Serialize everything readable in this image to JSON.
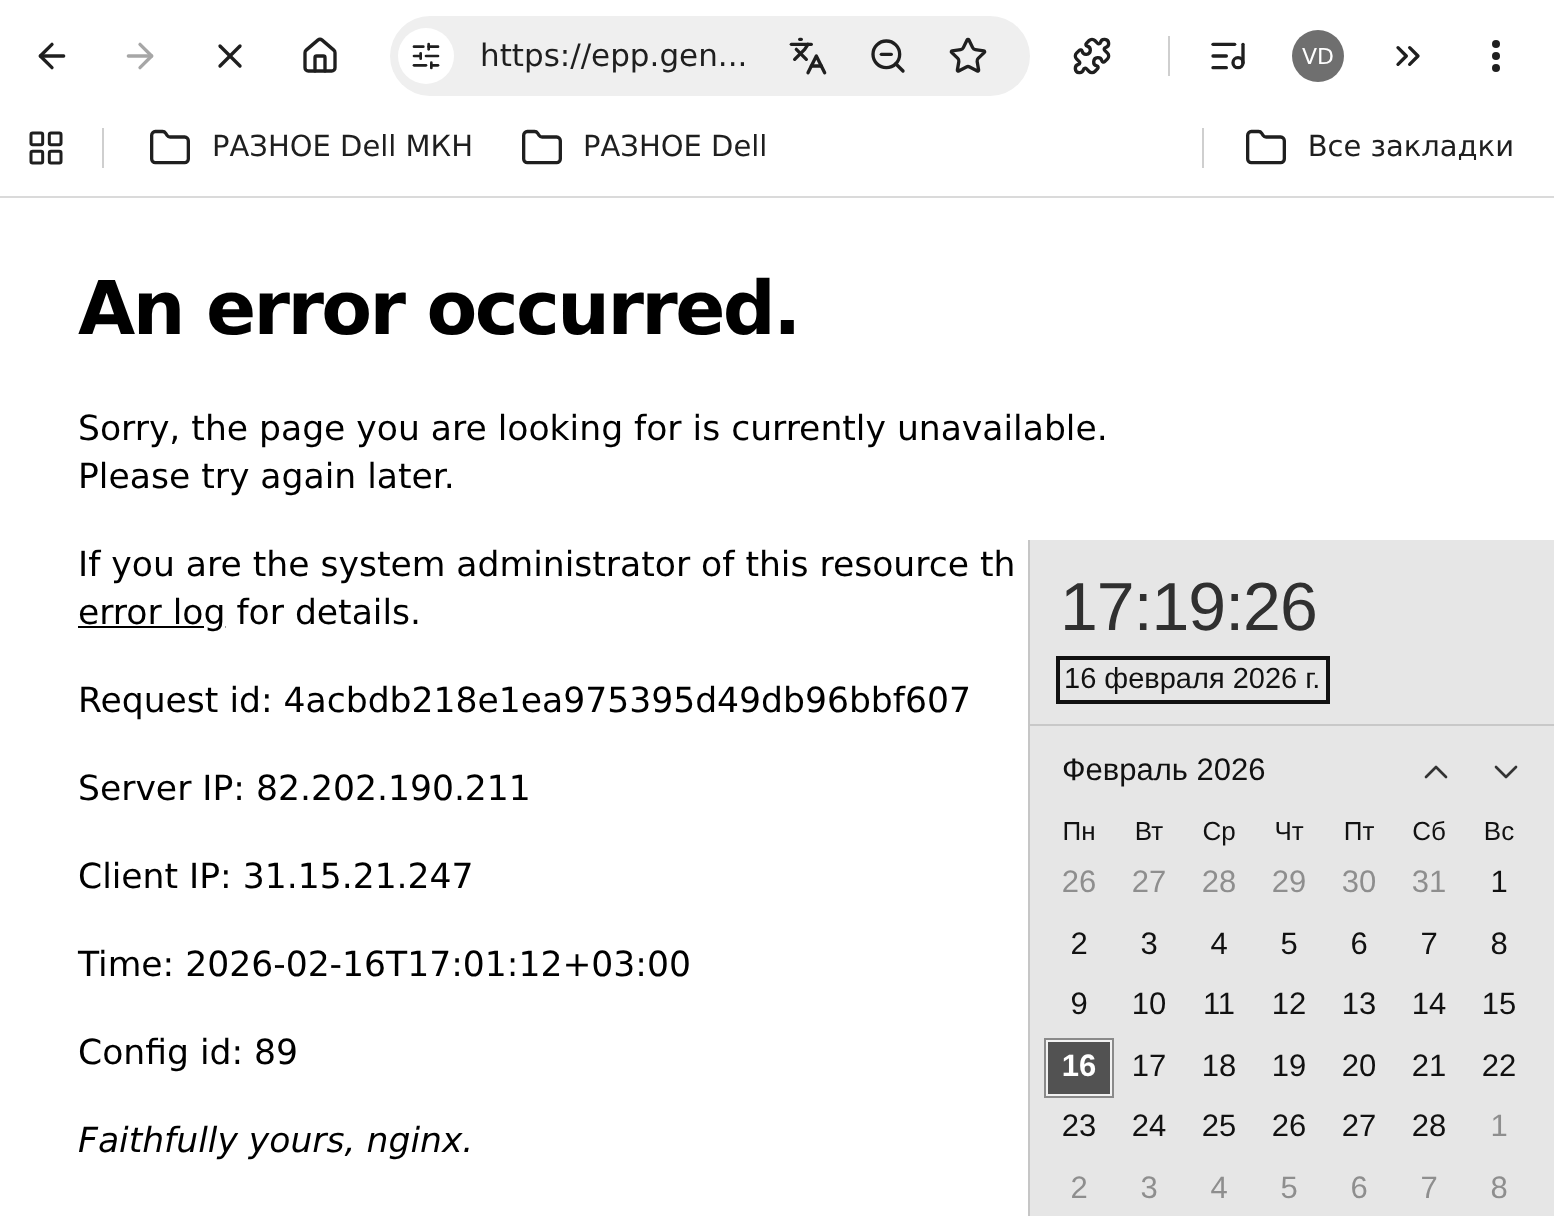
{
  "browser": {
    "forward_button": {
      "disabled": true
    },
    "address_bar": {
      "url": "https://epp.gen..."
    },
    "profile": {
      "initials": "VD"
    }
  },
  "bookmarks_bar": {
    "items": [
      {
        "label": "РАЗНОЕ Dell МКН"
      },
      {
        "label": "РАЗНОЕ Dell"
      }
    ],
    "all_bookmarks": {
      "label": "Все закладки"
    }
  },
  "page": {
    "heading": "An error occurred.",
    "paragraphs": [
      {
        "kind": "text",
        "lines": [
          "Sorry, the page you are looking for is currently unavailable.",
          "Please try again later."
        ]
      },
      {
        "kind": "log_hint",
        "lines": [
          "If you are the system administrator of this resource th"
        ],
        "link": "error log",
        "after_link": "for details."
      },
      {
        "kind": "info",
        "text": "Request id: 4acbdb218e1ea975395d49db96bbf607"
      },
      {
        "kind": "info",
        "text": "Server IP: 82.202.190.211"
      },
      {
        "kind": "info",
        "text": "Client IP: 31.15.21.247"
      },
      {
        "kind": "info",
        "text": "Time: 2026-02-16T17:01:12+03:00"
      },
      {
        "kind": "info",
        "text": "Config id: 89"
      },
      {
        "kind": "signature",
        "text": "Faithfully yours, nginx."
      }
    ]
  },
  "clock_flyout": {
    "time": "17:19:26",
    "date": "16 февраля 2026 г.",
    "month": "Февраль 2026",
    "weekdays": [
      "Пн",
      "Вт",
      "Ср",
      "Чт",
      "Пт",
      "Сб",
      "Вс"
    ],
    "days": [
      {
        "label": "26",
        "other_month": true,
        "selected": false
      },
      {
        "label": "27",
        "other_month": true,
        "selected": false
      },
      {
        "label": "28",
        "other_month": true,
        "selected": false
      },
      {
        "label": "29",
        "other_month": true,
        "selected": false
      },
      {
        "label": "30",
        "other_month": true,
        "selected": false
      },
      {
        "label": "31",
        "other_month": true,
        "selected": false
      },
      {
        "label": "1",
        "other_month": false,
        "selected": false
      },
      {
        "label": "2",
        "other_month": false,
        "selected": false
      },
      {
        "label": "3",
        "other_month": false,
        "selected": false
      },
      {
        "label": "4",
        "other_month": false,
        "selected": false
      },
      {
        "label": "5",
        "other_month": false,
        "selected": false
      },
      {
        "label": "6",
        "other_month": false,
        "selected": false
      },
      {
        "label": "7",
        "other_month": false,
        "selected": false
      },
      {
        "label": "8",
        "other_month": false,
        "selected": false
      },
      {
        "label": "9",
        "other_month": false,
        "selected": false
      },
      {
        "label": "10",
        "other_month": false,
        "selected": false
      },
      {
        "label": "11",
        "other_month": false,
        "selected": false
      },
      {
        "label": "12",
        "other_month": false,
        "selected": false
      },
      {
        "label": "13",
        "other_month": false,
        "selected": false
      },
      {
        "label": "14",
        "other_month": false,
        "selected": false
      },
      {
        "label": "15",
        "other_month": false,
        "selected": false
      },
      {
        "label": "16",
        "other_month": false,
        "selected": true
      },
      {
        "label": "17",
        "other_month": false,
        "selected": false
      },
      {
        "label": "18",
        "other_month": false,
        "selected": false
      },
      {
        "label": "19",
        "other_month": false,
        "selected": false
      },
      {
        "label": "20",
        "other_month": false,
        "selected": false
      },
      {
        "label": "21",
        "other_month": false,
        "selected": false
      },
      {
        "label": "22",
        "other_month": false,
        "selected": false
      },
      {
        "label": "23",
        "other_month": false,
        "selected": false
      },
      {
        "label": "24",
        "other_month": false,
        "selected": false
      },
      {
        "label": "25",
        "other_month": false,
        "selected": false
      },
      {
        "label": "26",
        "other_month": false,
        "selected": false
      },
      {
        "label": "27",
        "other_month": false,
        "selected": false
      },
      {
        "label": "28",
        "other_month": false,
        "selected": false
      },
      {
        "label": "1",
        "other_month": true,
        "selected": false
      },
      {
        "label": "2",
        "other_month": true,
        "selected": false
      },
      {
        "label": "3",
        "other_month": true,
        "selected": false
      },
      {
        "label": "4",
        "other_month": true,
        "selected": false
      },
      {
        "label": "5",
        "other_month": true,
        "selected": false
      },
      {
        "label": "6",
        "other_month": true,
        "selected": false
      },
      {
        "label": "7",
        "other_month": true,
        "selected": false
      },
      {
        "label": "8",
        "other_month": true,
        "selected": false
      }
    ]
  }
}
